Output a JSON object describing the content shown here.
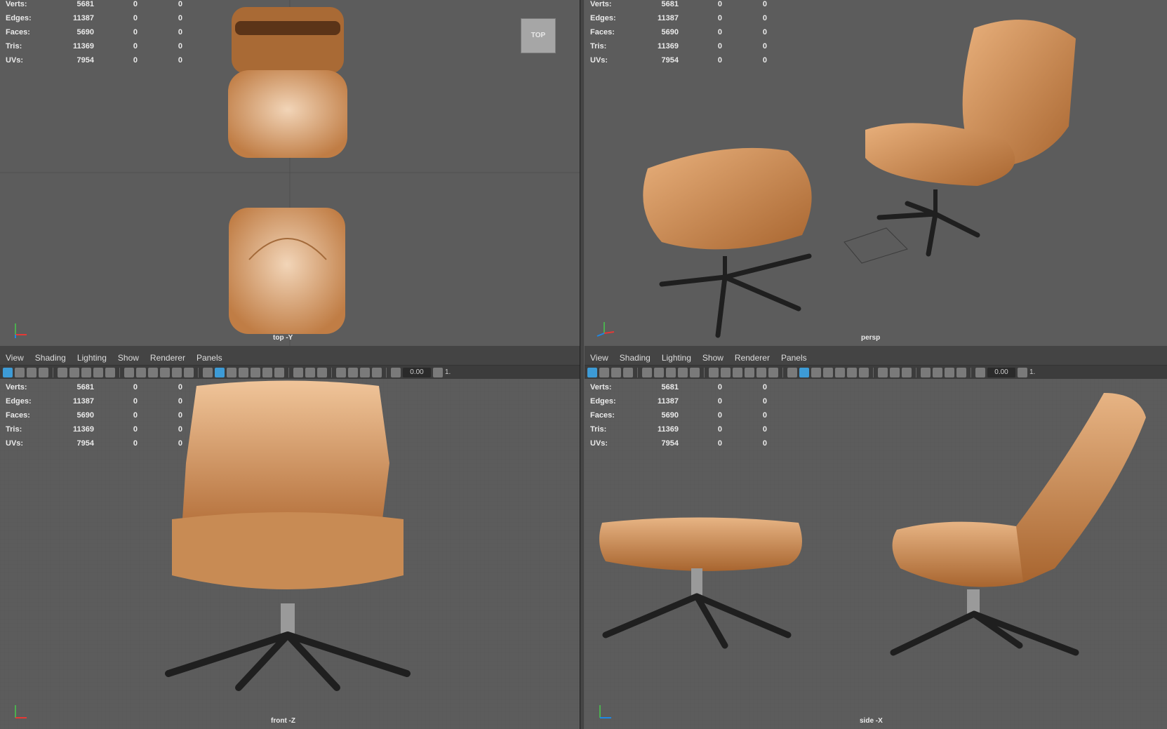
{
  "menu": {
    "items": [
      "View",
      "Shading",
      "Lighting",
      "Show",
      "Renderer",
      "Panels"
    ]
  },
  "toolbar": {
    "field_value": "0.00",
    "field_suffix": "1."
  },
  "hud": {
    "rows": [
      {
        "label": "Verts:",
        "v1": "5681",
        "v2": "0",
        "v3": "0"
      },
      {
        "label": "Edges:",
        "v1": "11387",
        "v2": "0",
        "v3": "0"
      },
      {
        "label": "Faces:",
        "v1": "5690",
        "v2": "0",
        "v3": "0"
      },
      {
        "label": "Tris:",
        "v1": "11369",
        "v2": "0",
        "v3": "0"
      },
      {
        "label": "UVs:",
        "v1": "7954",
        "v2": "0",
        "v3": "0"
      }
    ]
  },
  "viewports": {
    "top": {
      "camera": "top -Y",
      "viewcube": "TOP"
    },
    "persp": {
      "camera": "persp"
    },
    "front": {
      "camera": "front -Z"
    },
    "side": {
      "camera": "side -X"
    }
  },
  "colors": {
    "viewport_bg": "#5c5c5c",
    "leather": "#c98a52",
    "metal": "#1f1f1f",
    "active_icon": "#3d9bd6"
  }
}
